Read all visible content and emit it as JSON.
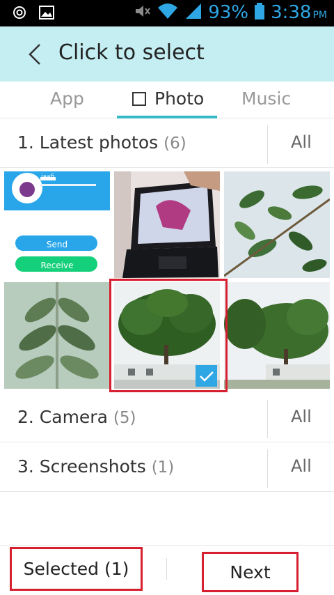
{
  "status_bar": {
    "battery_percent": "93%",
    "time": "3:38",
    "ampm": "PM",
    "icons": [
      "circle-status-icon",
      "image-notification-icon",
      "mute-icon",
      "wifi-icon",
      "signal-icon",
      "battery-icon"
    ]
  },
  "header": {
    "title": "Click to select",
    "background": "#c4eef2"
  },
  "tabs": [
    {
      "label": "App",
      "active": false
    },
    {
      "label": "Photo",
      "active": true
    },
    {
      "label": "Music",
      "active": false
    }
  ],
  "accent_color": "#35b9c9",
  "albums": [
    {
      "name": "1. Latest photos",
      "count": "(6)",
      "all_label": "All"
    },
    {
      "name": "2. Camera",
      "count": "(5)",
      "all_label": "All"
    },
    {
      "name": "3. Screenshots",
      "count": "(1)",
      "all_label": "All"
    }
  ],
  "photos": [
    {
      "subject": "app-screenshot",
      "selected": false,
      "buttons": [
        "Send",
        "Receive"
      ],
      "profile_text": "jaafi"
    },
    {
      "subject": "laptop",
      "selected": false
    },
    {
      "subject": "leaves",
      "selected": false
    },
    {
      "subject": "leaf-closeup",
      "selected": false
    },
    {
      "subject": "tree",
      "selected": true
    },
    {
      "subject": "tree-wide",
      "selected": false
    }
  ],
  "bottom_bar": {
    "selected_label": "Selected (1)",
    "next_label": "Next"
  },
  "highlight_color": "#d62030"
}
